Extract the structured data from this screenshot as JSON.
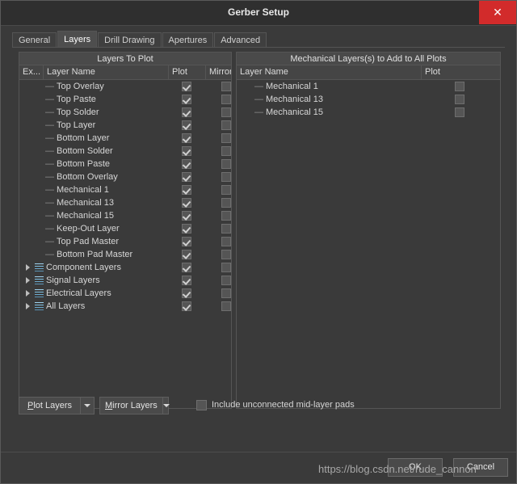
{
  "window": {
    "title": "Gerber Setup",
    "close_icon": "close-icon",
    "close_label": "✕"
  },
  "tabs": [
    {
      "label": "General",
      "active": false
    },
    {
      "label": "Layers",
      "active": true
    },
    {
      "label": "Drill Drawing",
      "active": false
    },
    {
      "label": "Apertures",
      "active": false
    },
    {
      "label": "Advanced",
      "active": false
    }
  ],
  "layers_to_plot": {
    "title": "Layers To Plot",
    "columns": [
      "Ex...",
      "Layer Name",
      "Plot",
      "Mirror"
    ],
    "rows": [
      {
        "name": "Top Overlay",
        "kind": "leaf",
        "plot": true,
        "mirror": false
      },
      {
        "name": "Top Paste",
        "kind": "leaf",
        "plot": true,
        "mirror": false
      },
      {
        "name": "Top Solder",
        "kind": "leaf",
        "plot": true,
        "mirror": false
      },
      {
        "name": "Top Layer",
        "kind": "leaf",
        "plot": true,
        "mirror": false
      },
      {
        "name": "Bottom Layer",
        "kind": "leaf",
        "plot": true,
        "mirror": false
      },
      {
        "name": "Bottom Solder",
        "kind": "leaf",
        "plot": true,
        "mirror": false
      },
      {
        "name": "Bottom Paste",
        "kind": "leaf",
        "plot": true,
        "mirror": false
      },
      {
        "name": "Bottom Overlay",
        "kind": "leaf",
        "plot": true,
        "mirror": false
      },
      {
        "name": "Mechanical 1",
        "kind": "leaf",
        "plot": true,
        "mirror": false
      },
      {
        "name": "Mechanical 13",
        "kind": "leaf",
        "plot": true,
        "mirror": false
      },
      {
        "name": "Mechanical 15",
        "kind": "leaf",
        "plot": true,
        "mirror": false
      },
      {
        "name": "Keep-Out Layer",
        "kind": "leaf",
        "plot": true,
        "mirror": false
      },
      {
        "name": "Top Pad Master",
        "kind": "leaf",
        "plot": true,
        "mirror": false
      },
      {
        "name": "Bottom Pad Master",
        "kind": "leaf",
        "plot": true,
        "mirror": false
      },
      {
        "name": "Component Layers",
        "kind": "group",
        "plot": true,
        "mirror": false
      },
      {
        "name": "Signal Layers",
        "kind": "group",
        "plot": true,
        "mirror": false
      },
      {
        "name": "Electrical Layers",
        "kind": "group",
        "plot": true,
        "mirror": false
      },
      {
        "name": "All Layers",
        "kind": "group",
        "plot": true,
        "mirror": false
      }
    ]
  },
  "mechanical_layers": {
    "title": "Mechanical Layers(s) to Add to All Plots",
    "columns": [
      "Layer Name",
      "Plot"
    ],
    "rows": [
      {
        "name": "Mechanical 1",
        "plot": false
      },
      {
        "name": "Mechanical 13",
        "plot": false
      },
      {
        "name": "Mechanical 15",
        "plot": false
      }
    ]
  },
  "bottom": {
    "plot_layers_label": "Plot Layers",
    "mirror_layers_label": "Mirror Layers",
    "include_label": "Include unconnected mid-layer pads",
    "include_checked": false
  },
  "footer": {
    "ok_label": "OK",
    "cancel_label": "Cancel"
  },
  "watermark": {
    "text": "https://blog.csdn.net/rude_cannon"
  }
}
